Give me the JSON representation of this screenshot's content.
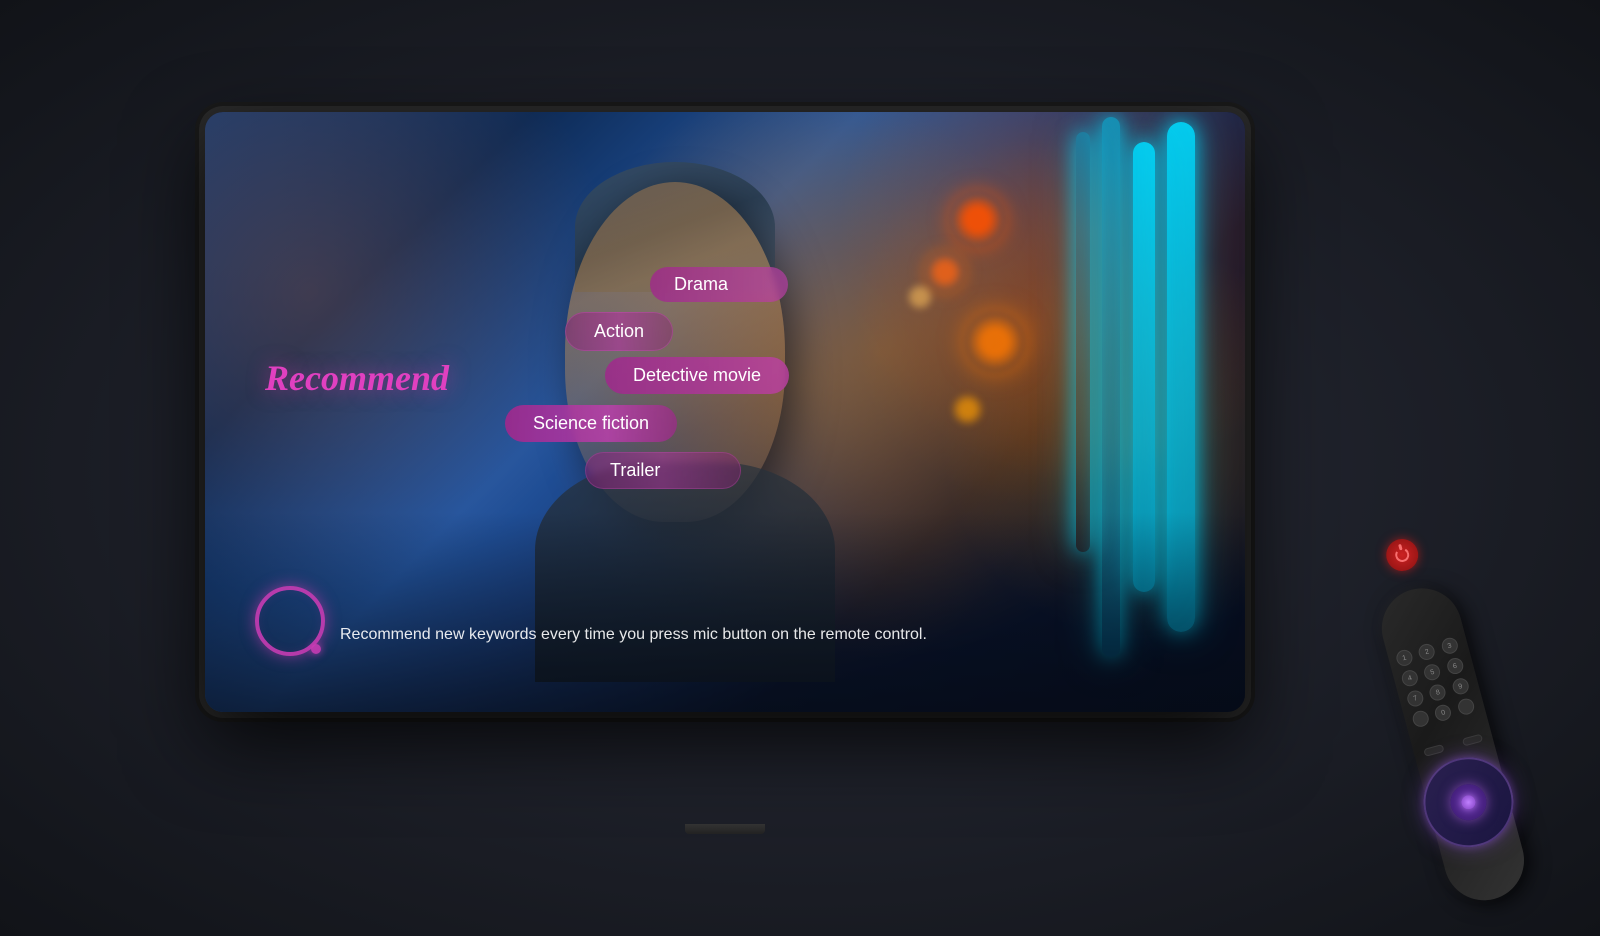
{
  "scene": {
    "background_color": "#1a1c24"
  },
  "tv": {
    "visible": true
  },
  "overlay": {
    "recommend_label": "Recommend",
    "voice_hint_text": "Recommend new keywords every time you press mic button on the remote control.",
    "keywords": [
      {
        "id": "drama",
        "label": "Drama",
        "row": 1
      },
      {
        "id": "action",
        "label": "Action",
        "row": 2
      },
      {
        "id": "detective",
        "label": "Detective movie",
        "row": 3
      },
      {
        "id": "scifi",
        "label": "Science fiction",
        "row": 4
      },
      {
        "id": "trailer",
        "label": "Trailer",
        "row": 5
      }
    ]
  },
  "remote": {
    "visible": true,
    "power_label": "⏻",
    "nav_buttons": [
      "1",
      "2",
      "3",
      "4",
      "5",
      "6",
      "7",
      "8",
      "9",
      "*",
      "0",
      "#"
    ]
  },
  "icons": {
    "voice_assistant": "circle-gradient",
    "power": "power-symbol",
    "dpad_center": "ok-button"
  }
}
